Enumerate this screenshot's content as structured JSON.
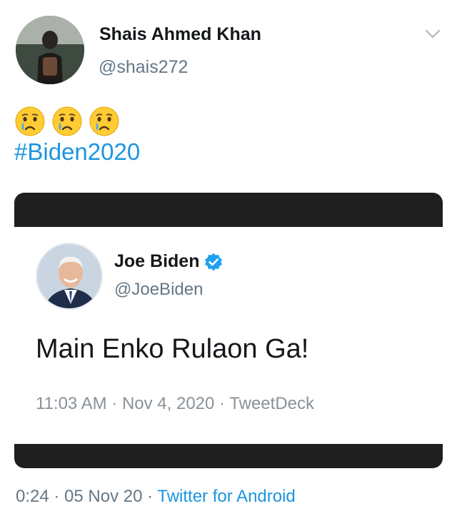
{
  "author": {
    "display_name": "Shais Ahmed Khan",
    "handle": "@shais272",
    "avatar_icon": "profile-photo-person-backpack"
  },
  "body": {
    "emojis": [
      "crying-face",
      "crying-face",
      "crying-face"
    ],
    "hashtag": "#Biden2020"
  },
  "embedded_tweet": {
    "display_name": "Joe Biden",
    "verified": true,
    "handle": "@JoeBiden",
    "text": "Main Enko Rulaon Ga!",
    "time": "11:03 AM",
    "date": "Nov 4, 2020",
    "source": "TweetDeck",
    "separator": " · "
  },
  "meta": {
    "time": "0:24",
    "date": "05 Nov 20",
    "source": "Twitter for Android",
    "separator": " · "
  },
  "colors": {
    "link": "#1b95e0",
    "secondary_text": "#657786",
    "verified_badge": "#1da1f2",
    "card_frame": "#1f1f1f"
  }
}
